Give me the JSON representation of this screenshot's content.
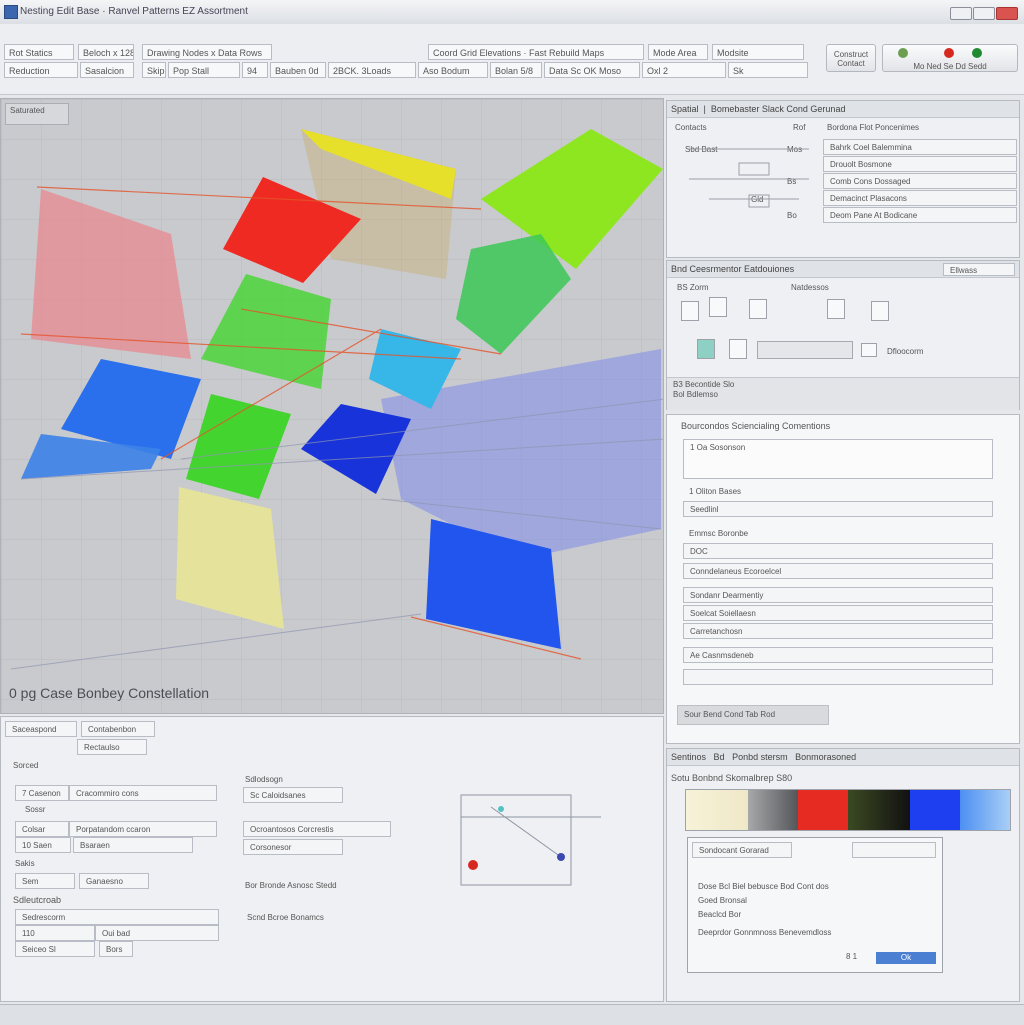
{
  "window": {
    "title": "Nesting Edit Base · Ranvel Patterns EZ Assortment"
  },
  "toolbar": {
    "row1": [
      "Rot Statics",
      "Beloch x 128",
      "Drawing Nodes x Data Rows",
      "Coord Grid Elevations · Fast Rebuild Maps",
      "Mode Area",
      "Modsite"
    ],
    "row2": [
      "Reduction",
      "Sasalcion",
      "Skip",
      "Pop Stall",
      "94",
      "Bauben 0d",
      "2BCK. 3Loads",
      "Aso Bodum",
      "Bolan 5/8",
      "Data Sc OK Moso",
      "Oxl 2",
      "Sk"
    ],
    "btn_left": "Construct Contact",
    "btn_right": "Mo Ned Se Dd Sedd"
  },
  "viewport": {
    "tag": "Saturated",
    "caption": "0 pg Case Bonbey Constellation",
    "colors": {
      "red": "#ee2a22",
      "yellow": "#e6e02a",
      "green": "#44d430",
      "lime": "#8ee620",
      "cyan": "#36b7e8",
      "blue": "#2255ee",
      "darkblue": "#1733d9",
      "pink": "#e88890",
      "pale_yellow": "#e8e596"
    }
  },
  "right_top": {
    "header": [
      "Spatial",
      "Bomebaster Slack Cond Gerunad"
    ],
    "sub": [
      "Contacts",
      "Rof",
      "Bordona Flot Poncenimes"
    ],
    "fields": [
      "Bahrk Coel Balemmina",
      "Drouolt Bosmone",
      "Comb Cons Dossaged",
      "Demacinct Plasacons",
      "Deom Pane At Bodicane"
    ],
    "side": [
      "Sbd Bast",
      "Mos",
      "Bs",
      "Gld",
      "Bo"
    ]
  },
  "right_mid": {
    "header": "Bnd Ceesrmentor Eatdouiones",
    "bar": "Ellwass",
    "labels": [
      "BS Zorm",
      "Natdessos",
      "Dfloocorm"
    ],
    "footer": [
      "B3 Becontide Slo",
      "Bol Bdlemso"
    ]
  },
  "right_doc": {
    "header": "Bourcondos Sciencialing Comentions",
    "rows": [
      "1 Oa Sosonson",
      "1 Oliton Bases",
      "Seedlinl",
      "Emmsc Boronbe",
      "DOC",
      "Conndelaneus Ecoroelcel",
      "Sondanr Dearmentiy",
      "Soelcat Soiellaesn",
      "Carretanchosn",
      "Ae Casnmsdeneb"
    ],
    "footer": "Sour Bend Cond Tab Rod"
  },
  "bottom_left": {
    "tabs": [
      "Saceaspond",
      "Contabenbon"
    ],
    "field1": "Rectaulso",
    "sect1": "Sorced",
    "rows1": [
      [
        "7 Casenon",
        "Cracommiro cons"
      ],
      [
        "Sossr",
        ""
      ],
      [
        "Colsar",
        "Porpatandom ccaron"
      ],
      [
        "10 Saen",
        "Bsaraen"
      ],
      [
        "Sakis",
        ""
      ],
      [
        "Sem",
        "Ganaesno"
      ]
    ],
    "sect2": "Sdleutcroab",
    "rows2": [
      [
        "Sedrescorm",
        ""
      ],
      [
        "110",
        "Oui bad"
      ],
      [
        "Seiceo Sl",
        "Bors"
      ]
    ],
    "mid_head": "Sdlodsogn",
    "mid_rows": [
      "Sc Caloidsanes",
      "Ocroantosos Corcrestis",
      "Corsonesor",
      "Bor Bronde Asnosc Stedd",
      "Scnd Bcroe Bonamcs"
    ]
  },
  "right_bottom": {
    "tabs": [
      "Sentinos",
      "Bd",
      "Ponbd stersm",
      "Bonmorasoned"
    ],
    "subtitle": "Sotu Bonbnd Skomalbrep S80",
    "swatches": [
      "#f3edd0",
      "#7c7d80",
      "#e52b22",
      "#2e3a1a",
      "#1e3ff0",
      "#6faaf2"
    ],
    "dialog": {
      "lines": [
        "Sondocant Gorarad",
        "Dose Bcl Biel bebusce Bod Cont dos",
        "Goed Bronsal",
        "Beaclcd Bor",
        "Deeprdor Gonnmnoss Benevemdloss"
      ],
      "ok": "Ok",
      "page": "8 1"
    }
  }
}
